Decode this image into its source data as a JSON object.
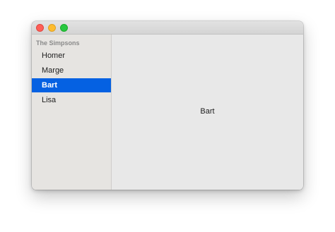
{
  "window": {
    "controls": [
      "close",
      "minimize",
      "zoom"
    ]
  },
  "sidebar": {
    "header": "The Simpsons",
    "items": [
      {
        "label": "Homer",
        "selected": false
      },
      {
        "label": "Marge",
        "selected": false
      },
      {
        "label": "Bart",
        "selected": true
      },
      {
        "label": "Lisa",
        "selected": false
      }
    ],
    "selection_color": "#0561e2"
  },
  "detail": {
    "text": "Bart"
  }
}
